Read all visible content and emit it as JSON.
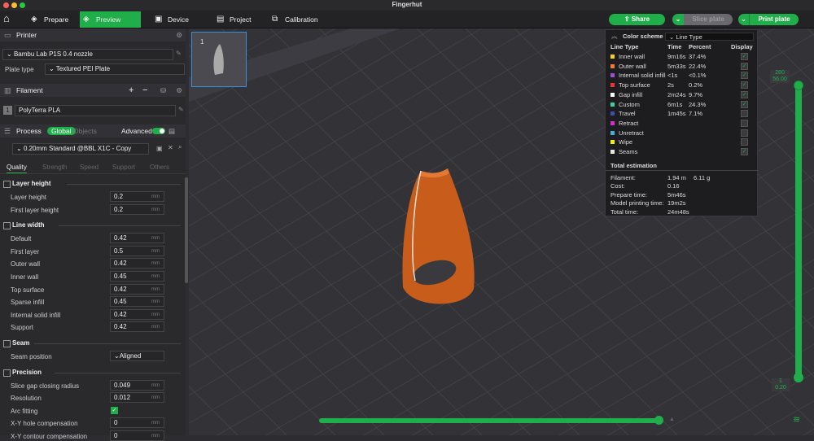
{
  "window": {
    "title": "Fingerhut"
  },
  "tabs": [
    {
      "label": "Prepare",
      "icon": "cube-icon"
    },
    {
      "label": "Preview",
      "icon": "preview-icon"
    },
    {
      "label": "Device",
      "icon": "device-icon"
    },
    {
      "label": "Project",
      "icon": "project-icon"
    },
    {
      "label": "Calibration",
      "icon": "calibration-icon"
    }
  ],
  "active_tab": "Preview",
  "actions": {
    "share": "Share",
    "slice": "Slice plate",
    "print": "Print plate"
  },
  "accent": "#1fae4a",
  "printer": {
    "header": "Printer",
    "name": "Bambu Lab P1S 0.4 nozzle",
    "plate_type_label": "Plate type",
    "plate_type": "Textured PEI Plate"
  },
  "filament": {
    "header": "Filament",
    "items": [
      {
        "index": "1",
        "name": "PolyTerra PLA"
      }
    ]
  },
  "process": {
    "header": "Process",
    "global": "Global",
    "objects": "Objects",
    "advanced": "Advanced",
    "advanced_on": true,
    "preset": "0.20mm Standard @BBL X1C - Copy",
    "tabs": [
      "Quality",
      "Strength",
      "Speed",
      "Support",
      "Others"
    ],
    "active_tab": "Quality"
  },
  "sections": [
    {
      "title": "Layer height",
      "rows": [
        {
          "label": "Layer height",
          "value": "0.2",
          "unit": "mm"
        },
        {
          "label": "First layer height",
          "value": "0.2",
          "unit": "mm"
        }
      ]
    },
    {
      "title": "Line width",
      "rows": [
        {
          "label": "Default",
          "value": "0.42",
          "unit": "mm"
        },
        {
          "label": "First layer",
          "value": "0.5",
          "unit": "mm"
        },
        {
          "label": "Outer wall",
          "value": "0.42",
          "unit": "mm"
        },
        {
          "label": "Inner wall",
          "value": "0.45",
          "unit": "mm"
        },
        {
          "label": "Top surface",
          "value": "0.42",
          "unit": "mm"
        },
        {
          "label": "Sparse infill",
          "value": "0.45",
          "unit": "mm"
        },
        {
          "label": "Internal solid infill",
          "value": "0.42",
          "unit": "mm"
        },
        {
          "label": "Support",
          "value": "0.42",
          "unit": "mm"
        }
      ]
    },
    {
      "title": "Seam",
      "rows": [
        {
          "label": "Seam position",
          "value": "Aligned",
          "type": "select"
        }
      ]
    },
    {
      "title": "Precision",
      "rows": [
        {
          "label": "Slice gap closing radius",
          "value": "0.049",
          "unit": "mm"
        },
        {
          "label": "Resolution",
          "value": "0.012",
          "unit": "mm"
        },
        {
          "label": "Arc fitting",
          "value": true,
          "type": "checkbox"
        },
        {
          "label": "X-Y hole compensation",
          "value": "0",
          "unit": "mm"
        },
        {
          "label": "X-Y contour compensation",
          "value": "0",
          "unit": "mm"
        }
      ]
    }
  ],
  "plate_thumb": {
    "number": "1"
  },
  "legend": {
    "title": "Color scheme",
    "scheme": "Line Type",
    "headers": [
      "Line Type",
      "Time",
      "Percent",
      "Display"
    ],
    "rows": [
      {
        "name": "Inner wall",
        "time": "9m16s",
        "percent": "37.4%",
        "color": "#f5d020",
        "display": true
      },
      {
        "name": "Outer wall",
        "time": "5m33s",
        "percent": "22.4%",
        "color": "#f07b30",
        "display": true
      },
      {
        "name": "Internal solid infill",
        "time": "<1s",
        "percent": "<0.1%",
        "color": "#9a4fd0",
        "display": true
      },
      {
        "name": "Top surface",
        "time": "2s",
        "percent": "0.2%",
        "color": "#e8333a",
        "display": true
      },
      {
        "name": "Gap infill",
        "time": "2m24s",
        "percent": "9.7%",
        "color": "#ffffff",
        "display": true
      },
      {
        "name": "Custom",
        "time": "6m1s",
        "percent": "24.3%",
        "color": "#3fcf9f",
        "display": true
      },
      {
        "name": "Travel",
        "time": "1m45s",
        "percent": "7.1%",
        "color": "#3d4fa8",
        "display": false
      },
      {
        "name": "Retract",
        "time": "",
        "percent": "",
        "color": "#d030d0",
        "display": false
      },
      {
        "name": "Unretract",
        "time": "",
        "percent": "",
        "color": "#40b0d8",
        "display": false
      },
      {
        "name": "Wipe",
        "time": "",
        "percent": "",
        "color": "#f0f000",
        "display": false
      },
      {
        "name": "Seams",
        "time": "",
        "percent": "",
        "color": "#e8e8e8",
        "display": true
      }
    ],
    "total_title": "Total estimation",
    "totals": [
      {
        "label": "Filament:",
        "value": "1.94 m",
        "extra": "6.11 g"
      },
      {
        "label": "Cost:",
        "value": "0.16"
      },
      {
        "label": "Prepare time:",
        "value": "5m46s"
      },
      {
        "label": "Model printing time:",
        "value": "19m2s"
      },
      {
        "label": "Total time:",
        "value": "24m48s"
      }
    ]
  },
  "layer_slider": {
    "top_layer": "280",
    "top_height": "56.00",
    "bottom_layer": "1",
    "bottom_height": "0.20"
  },
  "move_slider": {
    "percent": 100
  }
}
